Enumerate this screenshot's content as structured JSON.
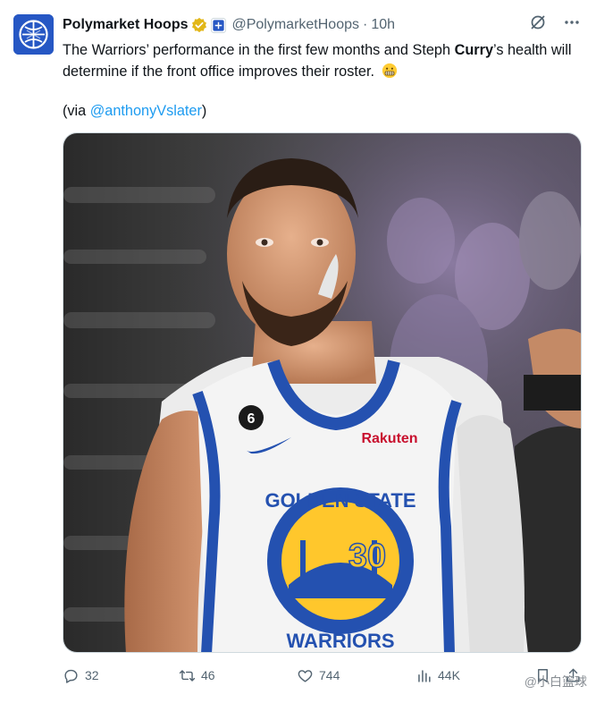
{
  "tweet": {
    "author_name": "Polymarket Hoops",
    "handle": "@PolymarketHoops",
    "separator": "·",
    "time": "10h",
    "text_part1": "The Warriors’ performance in the first few months and Steph ",
    "text_bold": "Curry",
    "text_part2": "’s health will determine if the front office improves their roster.",
    "via_prefix": "(via ",
    "via_mention": "@anthonyVslater",
    "via_suffix": ")",
    "image_text": {
      "jersey_top": "GOLDEN STATE",
      "jersey_number": "30",
      "jersey_bottom": "WARRIORS",
      "sponsor": "Rakuten",
      "patch": "6"
    }
  },
  "actions": {
    "replies": "32",
    "reposts": "46",
    "likes": "744",
    "views": "44K"
  },
  "watermark": {
    "text": "@小白篮球"
  },
  "colors": {
    "accent": "#1d9bf0",
    "secondary_text": "#536471",
    "verified_gold": "#e2b719"
  },
  "icons": {
    "grok": "grok-icon",
    "more": "more-icon",
    "reply": "reply-icon",
    "repost": "repost-icon",
    "like": "like-icon",
    "views": "views-icon",
    "bookmark": "bookmark-icon",
    "share": "share-icon"
  }
}
